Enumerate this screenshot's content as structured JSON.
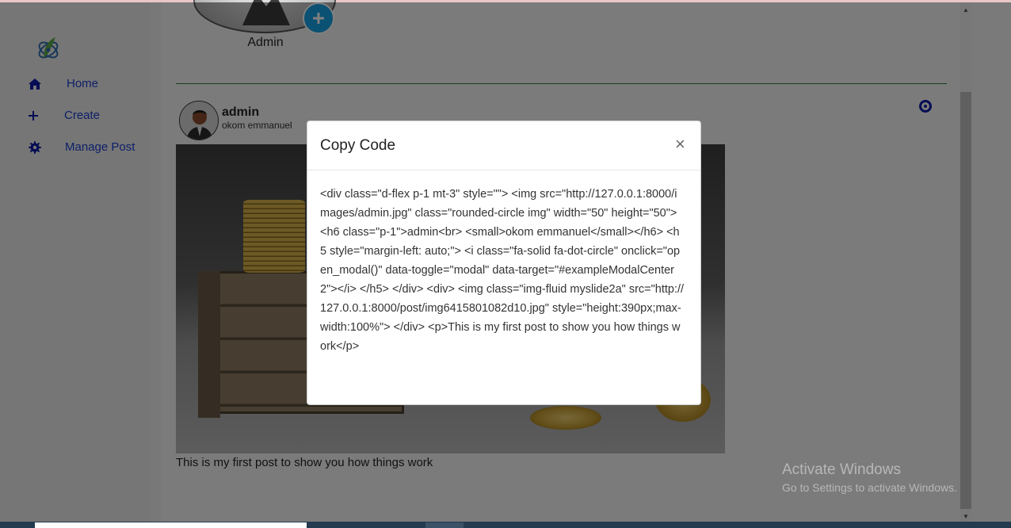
{
  "sidebar": {
    "items": [
      {
        "label": "Home",
        "icon": "home-icon"
      },
      {
        "label": "Create",
        "icon": "plus-icon"
      },
      {
        "label": "Manage Post",
        "icon": "gear-icon"
      }
    ]
  },
  "profile": {
    "name": "Admin"
  },
  "post": {
    "username": "admin",
    "fullname": "okom emmanuel",
    "caption": "This is my first post to show you how things work"
  },
  "modal": {
    "title": "Copy Code",
    "close_symbol": "×",
    "code": "<div class=\"d-flex p-1 mt-3\" style=\"\"> <img src=\"http://127.0.0.1:8000/images/admin.jpg\" class=\"rounded-circle img\" width=\"50\" height=\"50\"> <h6 class=\"p-1\">admin<br> <small>okom emmanuel</small></h6> <h5 style=\"margin-left: auto;\"> <i class=\"fa-solid fa-dot-circle\" onclick=\"open_modal()\" data-toggle=\"modal\" data-target=\"#exampleModalCenter2\"></i> </h5> </div> <div> <img class=\"img-fluid myslide2a\" src=\"http://127.0.0.1:8000/post/img6415801082d10.jpg\" style=\"height:390px;max-width:100%\"> </div> <p>This is my first post to show you how things work</p>"
  },
  "watermark": {
    "line1": "Activate Windows",
    "line2": "Go to Settings to activate Windows."
  },
  "colors": {
    "nav_link": "#1a3fd0",
    "accent_button": "#17a2e6",
    "divider": "#2e7d32",
    "dot_icon": "#0a1aa8"
  }
}
